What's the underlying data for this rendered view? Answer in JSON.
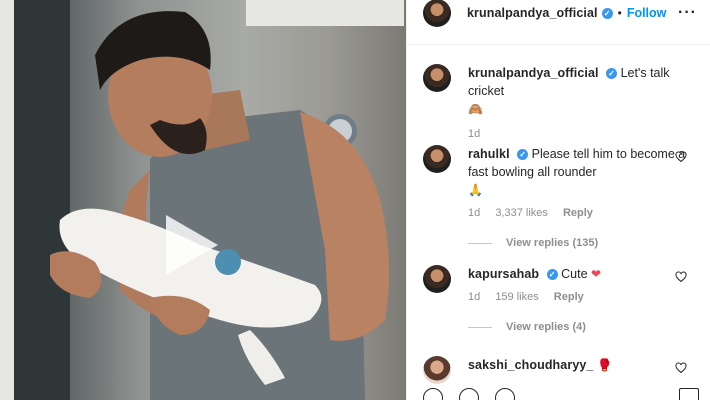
{
  "post": {
    "author": "krunalpandya_official",
    "follow_label": "Follow",
    "dot": "•",
    "more_label": "···",
    "verified_mark": "✓"
  },
  "caption": {
    "username": "krunalpandya_official",
    "text": "Let's talk cricket",
    "emoji": "🙈",
    "time": "1d"
  },
  "comments": [
    {
      "username": "rahulkl",
      "text": "Please tell him to become a fast bowling all rounder",
      "emoji": "🙏",
      "time": "1d",
      "likes": "3,337 likes",
      "reply_label": "Reply",
      "view_replies": "View replies (135)"
    },
    {
      "username": "kapursahab",
      "text": "Cute",
      "emoji": "❤",
      "time": "1d",
      "likes": "159 likes",
      "reply_label": "Reply",
      "view_replies": "View replies (4)"
    },
    {
      "username": "sakshi_choudharyy_",
      "emoji": "🥊"
    }
  ],
  "colors": {
    "accent": "#0095f6",
    "verified": "#3897f0",
    "heart": "#ed4956",
    "muted": "#8e8e8e"
  },
  "icons": {
    "play": "play-icon",
    "heart": "heart-outline-icon",
    "verified": "verified-badge-icon",
    "more": "more-options-icon"
  }
}
